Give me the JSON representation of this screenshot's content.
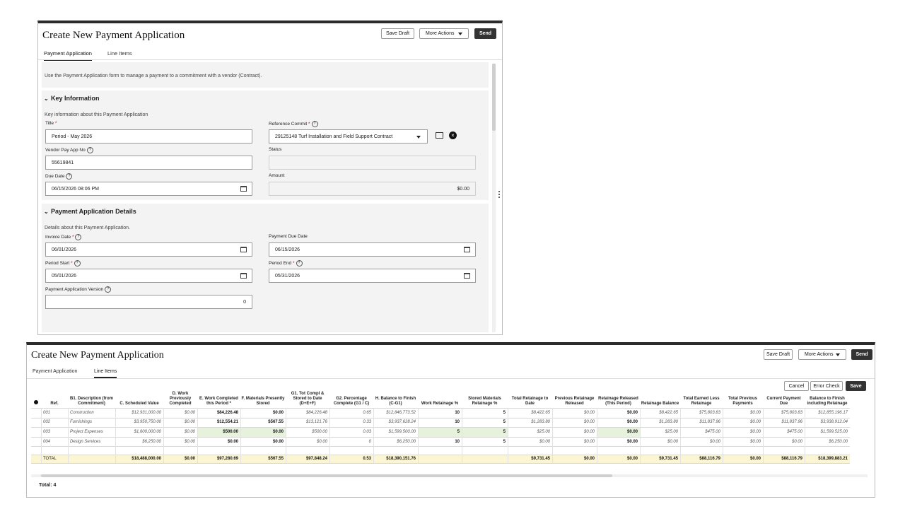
{
  "form": {
    "title": "Create New Payment Application",
    "save_draft": "Save Draft",
    "more_actions": "More Actions",
    "send": "Send",
    "tabs": [
      "Payment Application",
      "Line Items"
    ],
    "intro": "Use the Payment Application form to manage a payment to a commitment with a vendor (Contract).",
    "key_info": {
      "header": "Key Information",
      "desc": "Key information about this Payment Application",
      "title_label": "Title",
      "title_value": "Period - May 2026",
      "ref_label": "Reference Commit",
      "ref_value": "29125148 Turf Installation and Field Support Contract",
      "vendor_label": "Vendor Pay App No",
      "vendor_value": "55619841",
      "status_label": "Status",
      "status_value": "",
      "due_label": "Due Date",
      "due_value": "06/15/2026 08:06 PM",
      "amount_label": "Amount",
      "amount_value": "$0.00"
    },
    "details": {
      "header": "Payment Application Details",
      "desc": "Details about this Payment Application.",
      "invoice_label": "Invoice Date",
      "invoice_value": "06/01/2026",
      "paydue_label": "Payment Due Date",
      "paydue_value": "06/15/2026",
      "pstart_label": "Period Start",
      "pstart_value": "05/01/2026",
      "pend_label": "Period End",
      "pend_value": "05/31/2026",
      "version_label": "Payment Application Version",
      "version_value": "0"
    }
  },
  "lines": {
    "title": "Create New Payment Application",
    "save_draft": "Save Draft",
    "more_actions": "More Actions",
    "send": "Send",
    "tabs": [
      "Payment Application",
      "Line Items"
    ],
    "cancel": "Cancel",
    "error_check": "Error Check",
    "save": "Save",
    "headers": [
      "Ref.",
      "B1. Description (from Commitment)",
      "C. Scheduled Value",
      "D. Work Previously Completed",
      "E. Work Completed this Period *",
      "F. Materials Presently Stored",
      "G1. Tot Compl & Stored to Date (D+E+F)",
      "G2. Percentage Complete (G1 / C)",
      "H. Balance to Finish (C-G1)",
      "Work Retainage %",
      "Stored Materials Retainage %",
      "Total Retainage to Date",
      "Previous Retainage Released",
      "Retainage Released (This Period)",
      "Retainage Balance",
      "Total Earned Less Retainage",
      "Total Previous Payments",
      "Current Payment Due",
      "Balance to Finish including Retainage"
    ],
    "rows": [
      [
        "001",
        "Construction",
        "$12,931,000.00",
        "$0.00",
        "$84,226.48",
        "$0.00",
        "$84,226.48",
        "0.65",
        "$12,846,773.52",
        "10",
        "5",
        "$8,422.65",
        "$0.00",
        "$0.00",
        "$8,422.65",
        "$75,803.83",
        "$0.00",
        "$75,803.83",
        "$12,855,196.17"
      ],
      [
        "002",
        "Furnishings",
        "$3,950,750.00",
        "$0.00",
        "$12,554.21",
        "$567.55",
        "$13,121.76",
        "0.33",
        "$3,937,628.24",
        "10",
        "5",
        "$1,283.80",
        "$0.00",
        "$0.00",
        "$1,283.80",
        "$11,837.96",
        "$0.00",
        "$11,837.96",
        "$3,938,912.04"
      ],
      [
        "003",
        "Project Expenses",
        "$1,600,000.00",
        "$0.00",
        "$500.00",
        "$0.00",
        "$500.00",
        "0.03",
        "$1,599,500.00",
        "5",
        "5",
        "$25.00",
        "$0.00",
        "$0.00",
        "$25.00",
        "$475.00",
        "$0.00",
        "$475.00",
        "$1,599,525.00"
      ],
      [
        "004",
        "Design Services",
        "$6,250.00",
        "$0.00",
        "$0.00",
        "$0.00",
        "$0.00",
        "0",
        "$6,250.00",
        "10",
        "5",
        "$0.00",
        "$0.00",
        "$0.00",
        "$0.00",
        "$0.00",
        "$0.00",
        "$0.00",
        "$6,250.00"
      ]
    ],
    "total_row": [
      "TOTAL",
      "",
      "$18,488,000.00",
      "$0.00",
      "$97,280.69",
      "$567.55",
      "$97,848.24",
      "0.53",
      "$18,390,151.76",
      "",
      "",
      "$9,731.45",
      "$0.00",
      "$0.00",
      "$9,731.45",
      "$88,116.79",
      "$0.00",
      "$88,116.79",
      "$18,399,883.21"
    ],
    "total_count": "Total: 4"
  }
}
